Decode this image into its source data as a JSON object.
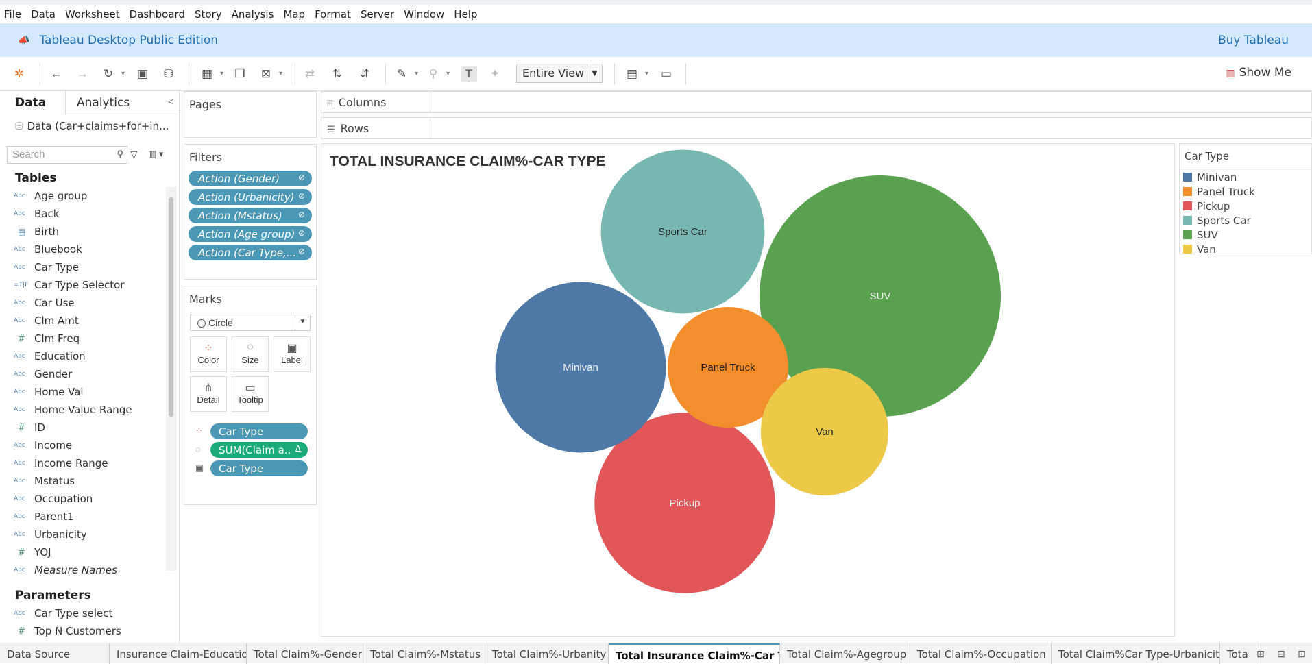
{
  "menu": [
    "File",
    "Data",
    "Worksheet",
    "Dashboard",
    "Story",
    "Analysis",
    "Map",
    "Format",
    "Server",
    "Window",
    "Help"
  ],
  "banner": {
    "title": "Tableau Desktop Public Edition",
    "buy_label": "Buy Tableau"
  },
  "toolbar": {
    "view_mode": "Entire View",
    "show_me": "Show Me"
  },
  "datapane": {
    "tab_data": "Data",
    "tab_analytics": "Analytics",
    "datasource": "Data (Car+claims+for+in...",
    "search_placeholder": "Search",
    "tables_header": "Tables",
    "fields": [
      {
        "type": "Abc",
        "name": "Age group"
      },
      {
        "type": "Abc",
        "name": "Back"
      },
      {
        "type": "date",
        "name": "Birth"
      },
      {
        "type": "Abc",
        "name": "Bluebook"
      },
      {
        "type": "Abc",
        "name": "Car Type"
      },
      {
        "type": "T|F",
        "name": "Car Type Selector"
      },
      {
        "type": "Abc",
        "name": "Car Use"
      },
      {
        "type": "Abc",
        "name": "Clm Amt"
      },
      {
        "type": "#",
        "name": "Clm Freq"
      },
      {
        "type": "Abc",
        "name": "Education"
      },
      {
        "type": "Abc",
        "name": "Gender"
      },
      {
        "type": "Abc",
        "name": "Home Val"
      },
      {
        "type": "Abc",
        "name": "Home Value Range"
      },
      {
        "type": "#",
        "name": "ID"
      },
      {
        "type": "Abc",
        "name": "Income"
      },
      {
        "type": "Abc",
        "name": "Income Range"
      },
      {
        "type": "Abc",
        "name": "Mstatus"
      },
      {
        "type": "Abc",
        "name": "Occupation"
      },
      {
        "type": "Abc",
        "name": "Parent1"
      },
      {
        "type": "Abc",
        "name": "Urbanicity"
      },
      {
        "type": "#",
        "name": "YOJ"
      },
      {
        "type": "Abc",
        "name": "Measure Names"
      }
    ],
    "parameters_header": "Parameters",
    "parameters": [
      {
        "type": "Abc",
        "name": "Car Type select"
      },
      {
        "type": "#",
        "name": "Top N Customers"
      }
    ]
  },
  "pages": {
    "title": "Pages"
  },
  "filters": {
    "title": "Filters",
    "items": [
      "Action (Gender)",
      "Action (Urbanicity)",
      "Action (Mstatus)",
      "Action (Age group)",
      "Action (Car Type,..."
    ]
  },
  "marks": {
    "title": "Marks",
    "mark_type": "Circle",
    "buttons": [
      "Color",
      "Size",
      "Label",
      "Detail",
      "Tooltip"
    ],
    "pills": [
      "Car Type",
      "SUM(Claim a..",
      "Car Type"
    ]
  },
  "shelves": {
    "columns": "Columns",
    "rows": "Rows"
  },
  "view": {
    "title": "TOTAL INSURANCE CLAIM%-CAR TYPE"
  },
  "legend": {
    "title": "Car Type",
    "items": [
      {
        "label": "Minivan",
        "color": "#4e79a7"
      },
      {
        "label": "Panel Truck",
        "color": "#f28e2b"
      },
      {
        "label": "Pickup",
        "color": "#e15759"
      },
      {
        "label": "Sports Car",
        "color": "#76b7b2"
      },
      {
        "label": "SUV",
        "color": "#59a14f"
      },
      {
        "label": "Van",
        "color": "#edc948"
      }
    ]
  },
  "chart_data": {
    "type": "packed-bubble",
    "title": "TOTAL INSURANCE CLAIM%-CAR TYPE",
    "categories": [
      "SUV",
      "Pickup",
      "Minivan",
      "Sports Car",
      "Panel Truck",
      "Van"
    ],
    "relative_size": [
      1.0,
      0.56,
      0.5,
      0.46,
      0.25,
      0.28
    ],
    "colors": [
      "#59a14f",
      "#e15759",
      "#4e79a7",
      "#76b7b2",
      "#f28e2b",
      "#edc948"
    ]
  },
  "sheet_tabs": [
    {
      "label": "Data Source",
      "active": false
    },
    {
      "label": "Insurance Claim-Education",
      "active": false
    },
    {
      "label": "Total Claim%-Gender",
      "active": false
    },
    {
      "label": "Total Claim%-Mstatus",
      "active": false
    },
    {
      "label": "Total Claim%-Urbanity",
      "active": false
    },
    {
      "label": "Total Insurance Claim%-Car T...",
      "active": true
    },
    {
      "label": "Total Claim%-Agegroup",
      "active": false
    },
    {
      "label": "Total Claim%-Occupation",
      "active": false
    },
    {
      "label": "Total Claim%Car Type-Urbanicity",
      "active": false
    },
    {
      "label": "Tota",
      "active": false
    }
  ]
}
